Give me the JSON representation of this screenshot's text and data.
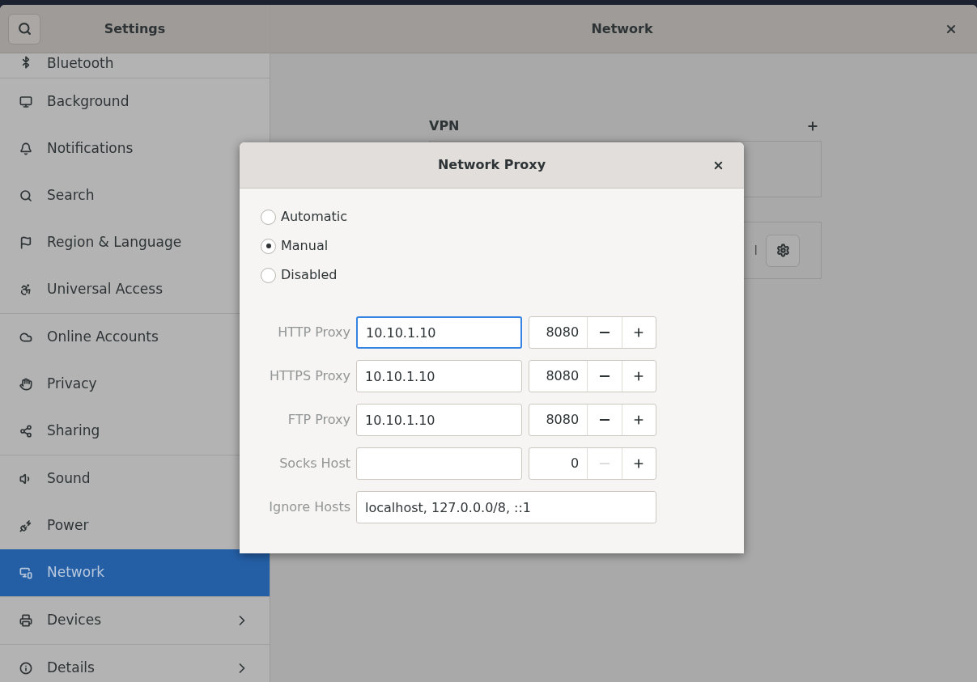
{
  "sidebar": {
    "title": "Settings",
    "groups": [
      [
        {
          "label": "Bluetooth",
          "selected": false,
          "submenu": false
        }
      ],
      [
        {
          "label": "Background",
          "selected": false,
          "submenu": false
        },
        {
          "label": "Notifications",
          "selected": false,
          "submenu": false
        },
        {
          "label": "Search",
          "selected": false,
          "submenu": false
        },
        {
          "label": "Region & Language",
          "selected": false,
          "submenu": false
        },
        {
          "label": "Universal Access",
          "selected": false,
          "submenu": false
        }
      ],
      [
        {
          "label": "Online Accounts",
          "selected": false,
          "submenu": false
        },
        {
          "label": "Privacy",
          "selected": false,
          "submenu": false
        },
        {
          "label": "Sharing",
          "selected": false,
          "submenu": false
        }
      ],
      [
        {
          "label": "Sound",
          "selected": false,
          "submenu": false
        },
        {
          "label": "Power",
          "selected": false,
          "submenu": false
        },
        {
          "label": "Network",
          "selected": true,
          "submenu": false
        }
      ],
      [
        {
          "label": "Devices",
          "selected": false,
          "submenu": true
        }
      ],
      [
        {
          "label": "Details",
          "selected": false,
          "submenu": true
        }
      ]
    ]
  },
  "main": {
    "title": "Network",
    "vpn": {
      "heading": "VPN"
    },
    "row_text": "l"
  },
  "dialog": {
    "title": "Network Proxy",
    "modes": [
      {
        "label": "Automatic",
        "selected": false
      },
      {
        "label": "Manual",
        "selected": true
      },
      {
        "label": "Disabled",
        "selected": false
      }
    ],
    "proxies": [
      {
        "label": "HTTP Proxy",
        "host": "10.10.1.10",
        "port": "8080",
        "focused": true,
        "minus_disabled": false
      },
      {
        "label": "HTTPS Proxy",
        "host": "10.10.1.10",
        "port": "8080",
        "focused": false,
        "minus_disabled": false
      },
      {
        "label": "FTP Proxy",
        "host": "10.10.1.10",
        "port": "8080",
        "focused": false,
        "minus_disabled": false
      },
      {
        "label": "Socks Host",
        "port": "0",
        "focused": false,
        "minus_disabled": true
      }
    ],
    "ignore": {
      "label": "Ignore Hosts",
      "value": "localhost, 127.0.0.0/8, ::1"
    }
  }
}
